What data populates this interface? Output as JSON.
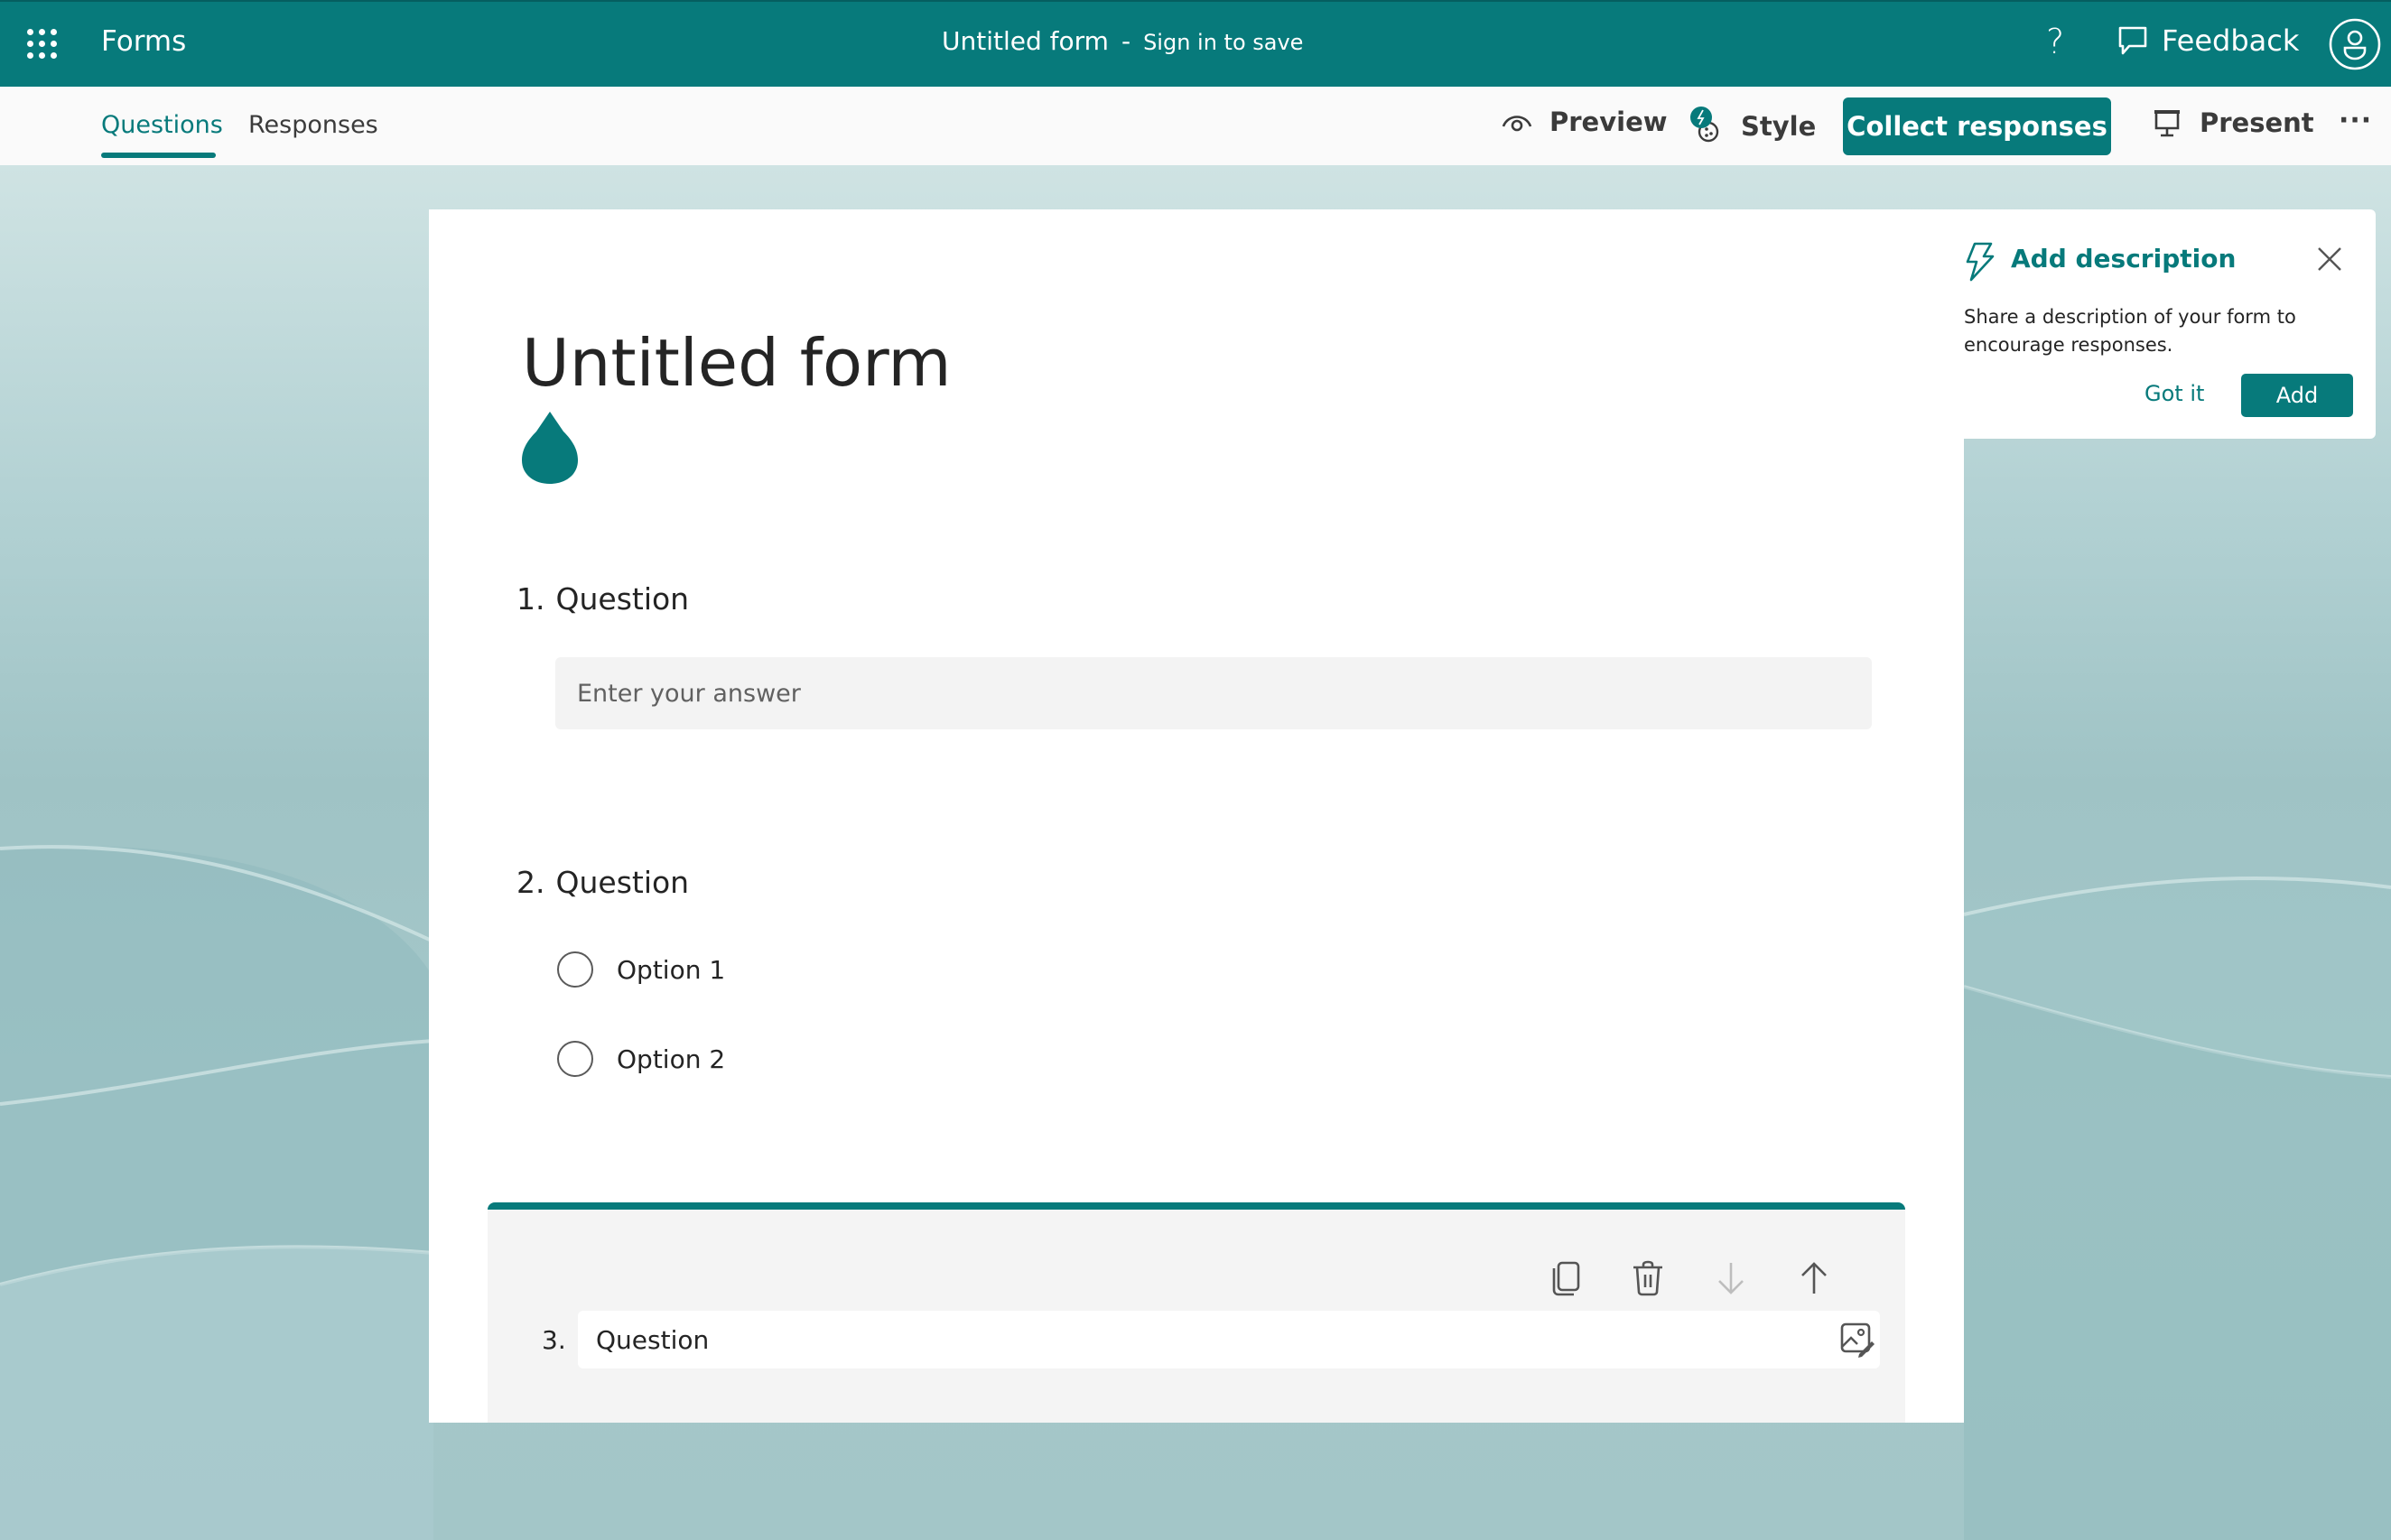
{
  "topbar": {
    "app_name": "Forms",
    "doc_title": "Untitled form",
    "separator": "-",
    "signin_label": "Sign in to save",
    "help_label": "?",
    "feedback_label": "Feedback"
  },
  "tabs": [
    {
      "label": "Questions",
      "active": true
    },
    {
      "label": "Responses",
      "active": false
    }
  ],
  "commands": {
    "preview_label": "Preview",
    "style_label": "Style",
    "collect_label": "Collect responses",
    "present_label": "Present",
    "more_label": "···"
  },
  "form": {
    "title": "Untitled form",
    "questions": [
      {
        "number": "1.",
        "title": "Question",
        "type": "text",
        "placeholder": "Enter your answer"
      },
      {
        "number": "2.",
        "title": "Question",
        "type": "choice",
        "options": [
          "Option 1",
          "Option 2"
        ]
      },
      {
        "number": "3.",
        "title": "Question",
        "type": "editing",
        "value": "Question"
      }
    ]
  },
  "popup": {
    "title": "Add description",
    "body": "Share a description of your form to encourage responses.",
    "gotit_label": "Got it",
    "add_label": "Add"
  },
  "colors": {
    "accent": "#077a7b",
    "tabbar_bg": "#fafafa",
    "input_bg": "#f3f3f3"
  }
}
